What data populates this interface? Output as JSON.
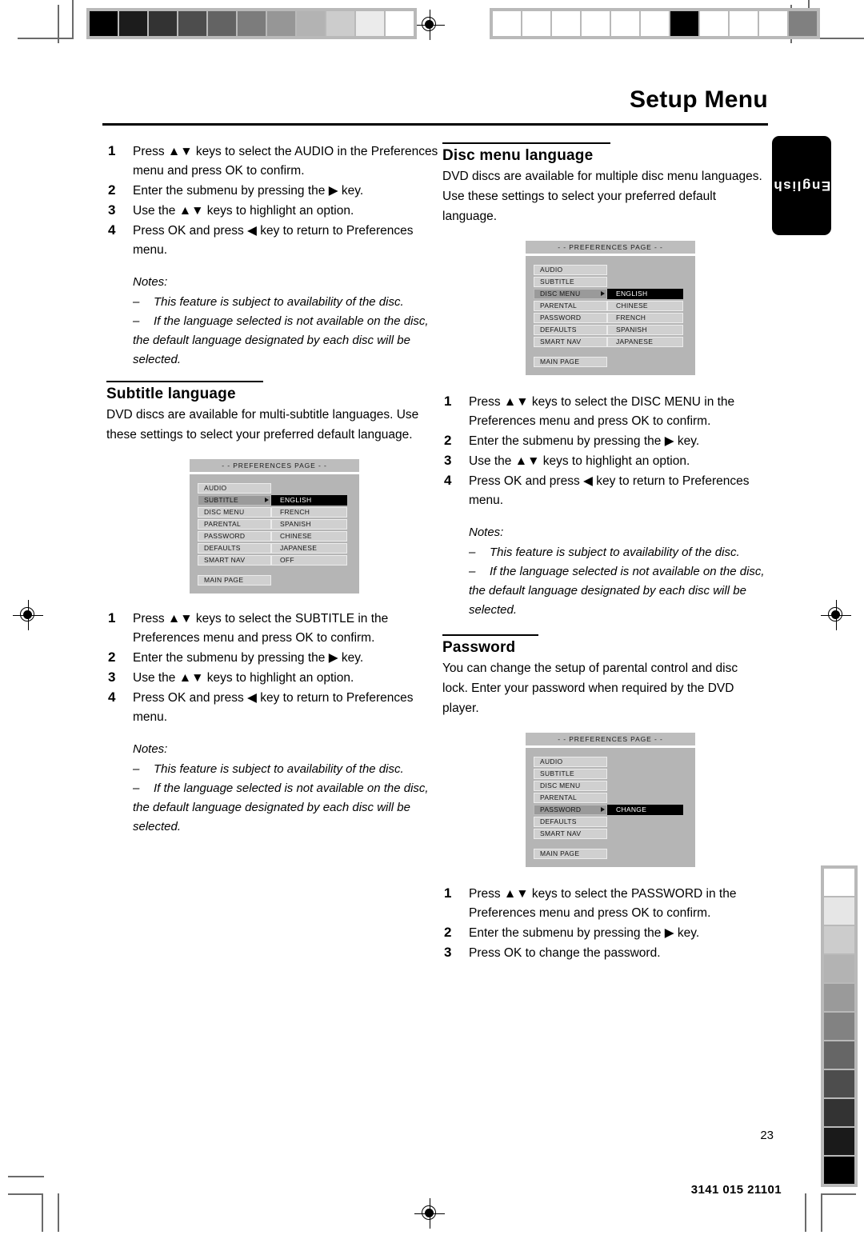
{
  "header": {
    "title": "Setup Menu",
    "language_tab": "English"
  },
  "footer": {
    "page_number": "23",
    "doc_code": "3141 015 21101"
  },
  "sections": {
    "audio_steps": {
      "steps": [
        {
          "num": "1",
          "text": "Press ▲▼ keys to select the AUDIO in the Preferences menu and press OK to confirm."
        },
        {
          "num": "2",
          "text": "Enter the submenu by pressing the ▶ key."
        },
        {
          "num": "3",
          "text": "Use the ▲▼ keys to highlight an option."
        },
        {
          "num": "4",
          "text": "Press OK and press ◀ key to return to Preferences menu."
        }
      ],
      "notes_title": "Notes:",
      "notes": [
        "This feature is subject to availability of the disc.",
        "If the language selected is not available on the disc, the default language designated by each disc will be selected."
      ]
    },
    "subtitle_language": {
      "heading": "Subtitle language",
      "body": "DVD discs are available for multi-subtitle languages. Use these settings to select your preferred default language.",
      "steps": [
        {
          "num": "1",
          "text": "Press ▲▼ keys to select the SUBTITLE in the Preferences menu and press OK to confirm."
        },
        {
          "num": "2",
          "text": "Enter the submenu by pressing the ▶ key."
        },
        {
          "num": "3",
          "text": "Use the ▲▼ keys to highlight an option."
        },
        {
          "num": "4",
          "text": "Press OK and press ◀ key to return to Preferences menu."
        }
      ],
      "notes_title": "Notes:",
      "notes": [
        "This feature is subject to availability of the disc.",
        "If the language selected is not available on the disc, the default language designated by each disc will be selected."
      ]
    },
    "disc_menu_language": {
      "heading": "Disc menu language",
      "body": "DVD discs are available for multiple disc menu languages. Use these settings to select your preferred default language.",
      "steps": [
        {
          "num": "1",
          "text": "Press ▲▼ keys to select the DISC MENU in the Preferences menu and press OK to confirm."
        },
        {
          "num": "2",
          "text": "Enter the submenu by pressing the ▶ key."
        },
        {
          "num": "3",
          "text": "Use the ▲▼ keys to highlight an option."
        },
        {
          "num": "4",
          "text": "Press OK and press ◀ key to return to Preferences menu."
        }
      ],
      "notes_title": "Notes:",
      "notes": [
        "This feature is subject to availability of the disc.",
        "If the language selected is not available on the disc, the default language designated by each disc will be selected."
      ]
    },
    "password": {
      "heading": "Password",
      "body": "You can change the setup of parental control and disc lock. Enter your password when required by the DVD player.",
      "steps": [
        {
          "num": "1",
          "text": "Press ▲▼ keys to select the PASSWORD in the Preferences menu and press OK to confirm."
        },
        {
          "num": "2",
          "text": "Enter the submenu by pressing the ▶ key."
        },
        {
          "num": "3",
          "text": "Press OK to change the password."
        }
      ]
    }
  },
  "osd_screens": {
    "subtitle": {
      "title": "- -  PREFERENCES PAGE  - -",
      "menu_items": [
        "AUDIO",
        "SUBTITLE",
        "DISC MENU",
        "PARENTAL",
        "PASSWORD",
        "DEFAULTS",
        "SMART NAV"
      ],
      "selected_item": "SUBTITLE",
      "selected_index": 1,
      "options": [
        "ENGLISH",
        "FRENCH",
        "SPANISH",
        "CHINESE",
        "JAPANESE",
        "OFF"
      ],
      "highlighted_option": "ENGLISH",
      "main_page_label": "MAIN PAGE"
    },
    "disc_menu": {
      "title": "- -  PREFERENCES PAGE  - -",
      "menu_items": [
        "AUDIO",
        "SUBTITLE",
        "DISC MENU",
        "PARENTAL",
        "PASSWORD",
        "DEFAULTS",
        "SMART NAV"
      ],
      "selected_item": "DISC MENU",
      "selected_index": 2,
      "options": [
        "ENGLISH",
        "CHINESE",
        "FRENCH",
        "SPANISH",
        "JAPANESE"
      ],
      "highlighted_option": "ENGLISH",
      "main_page_label": "MAIN PAGE"
    },
    "password": {
      "title": "- -  PREFERENCES PAGE  - -",
      "menu_items": [
        "AUDIO",
        "SUBTITLE",
        "DISC MENU",
        "PARENTAL",
        "PASSWORD",
        "DEFAULTS",
        "SMART NAV"
      ],
      "selected_item": "PASSWORD",
      "selected_index": 4,
      "options": [
        "CHANGE"
      ],
      "highlighted_option": "CHANGE",
      "main_page_label": "MAIN PAGE"
    }
  },
  "calibration": {
    "top_left_swatches": [
      "#000000",
      "#1c1c1c",
      "#333333",
      "#4d4d4d",
      "#636363",
      "#7c7c7c",
      "#969696",
      "#b3b3b3",
      "#cccccc",
      "#ebebeb",
      "#ffffff"
    ],
    "top_right_swatches": [
      "#ffffff",
      "#ffffff",
      "#ffffff",
      "#ffffff",
      "#ffffff",
      "#ffffff",
      "#000000",
      "#ffffff",
      "#ffffff",
      "#ffffff",
      "#808080"
    ],
    "right_vertical_swatches": [
      "#ffffff",
      "#e6e6e6",
      "#cccccc",
      "#b3b3b3",
      "#9a9a9a",
      "#828282",
      "#666666",
      "#4d4d4d",
      "#333333",
      "#1a1a1a",
      "#000000"
    ]
  }
}
